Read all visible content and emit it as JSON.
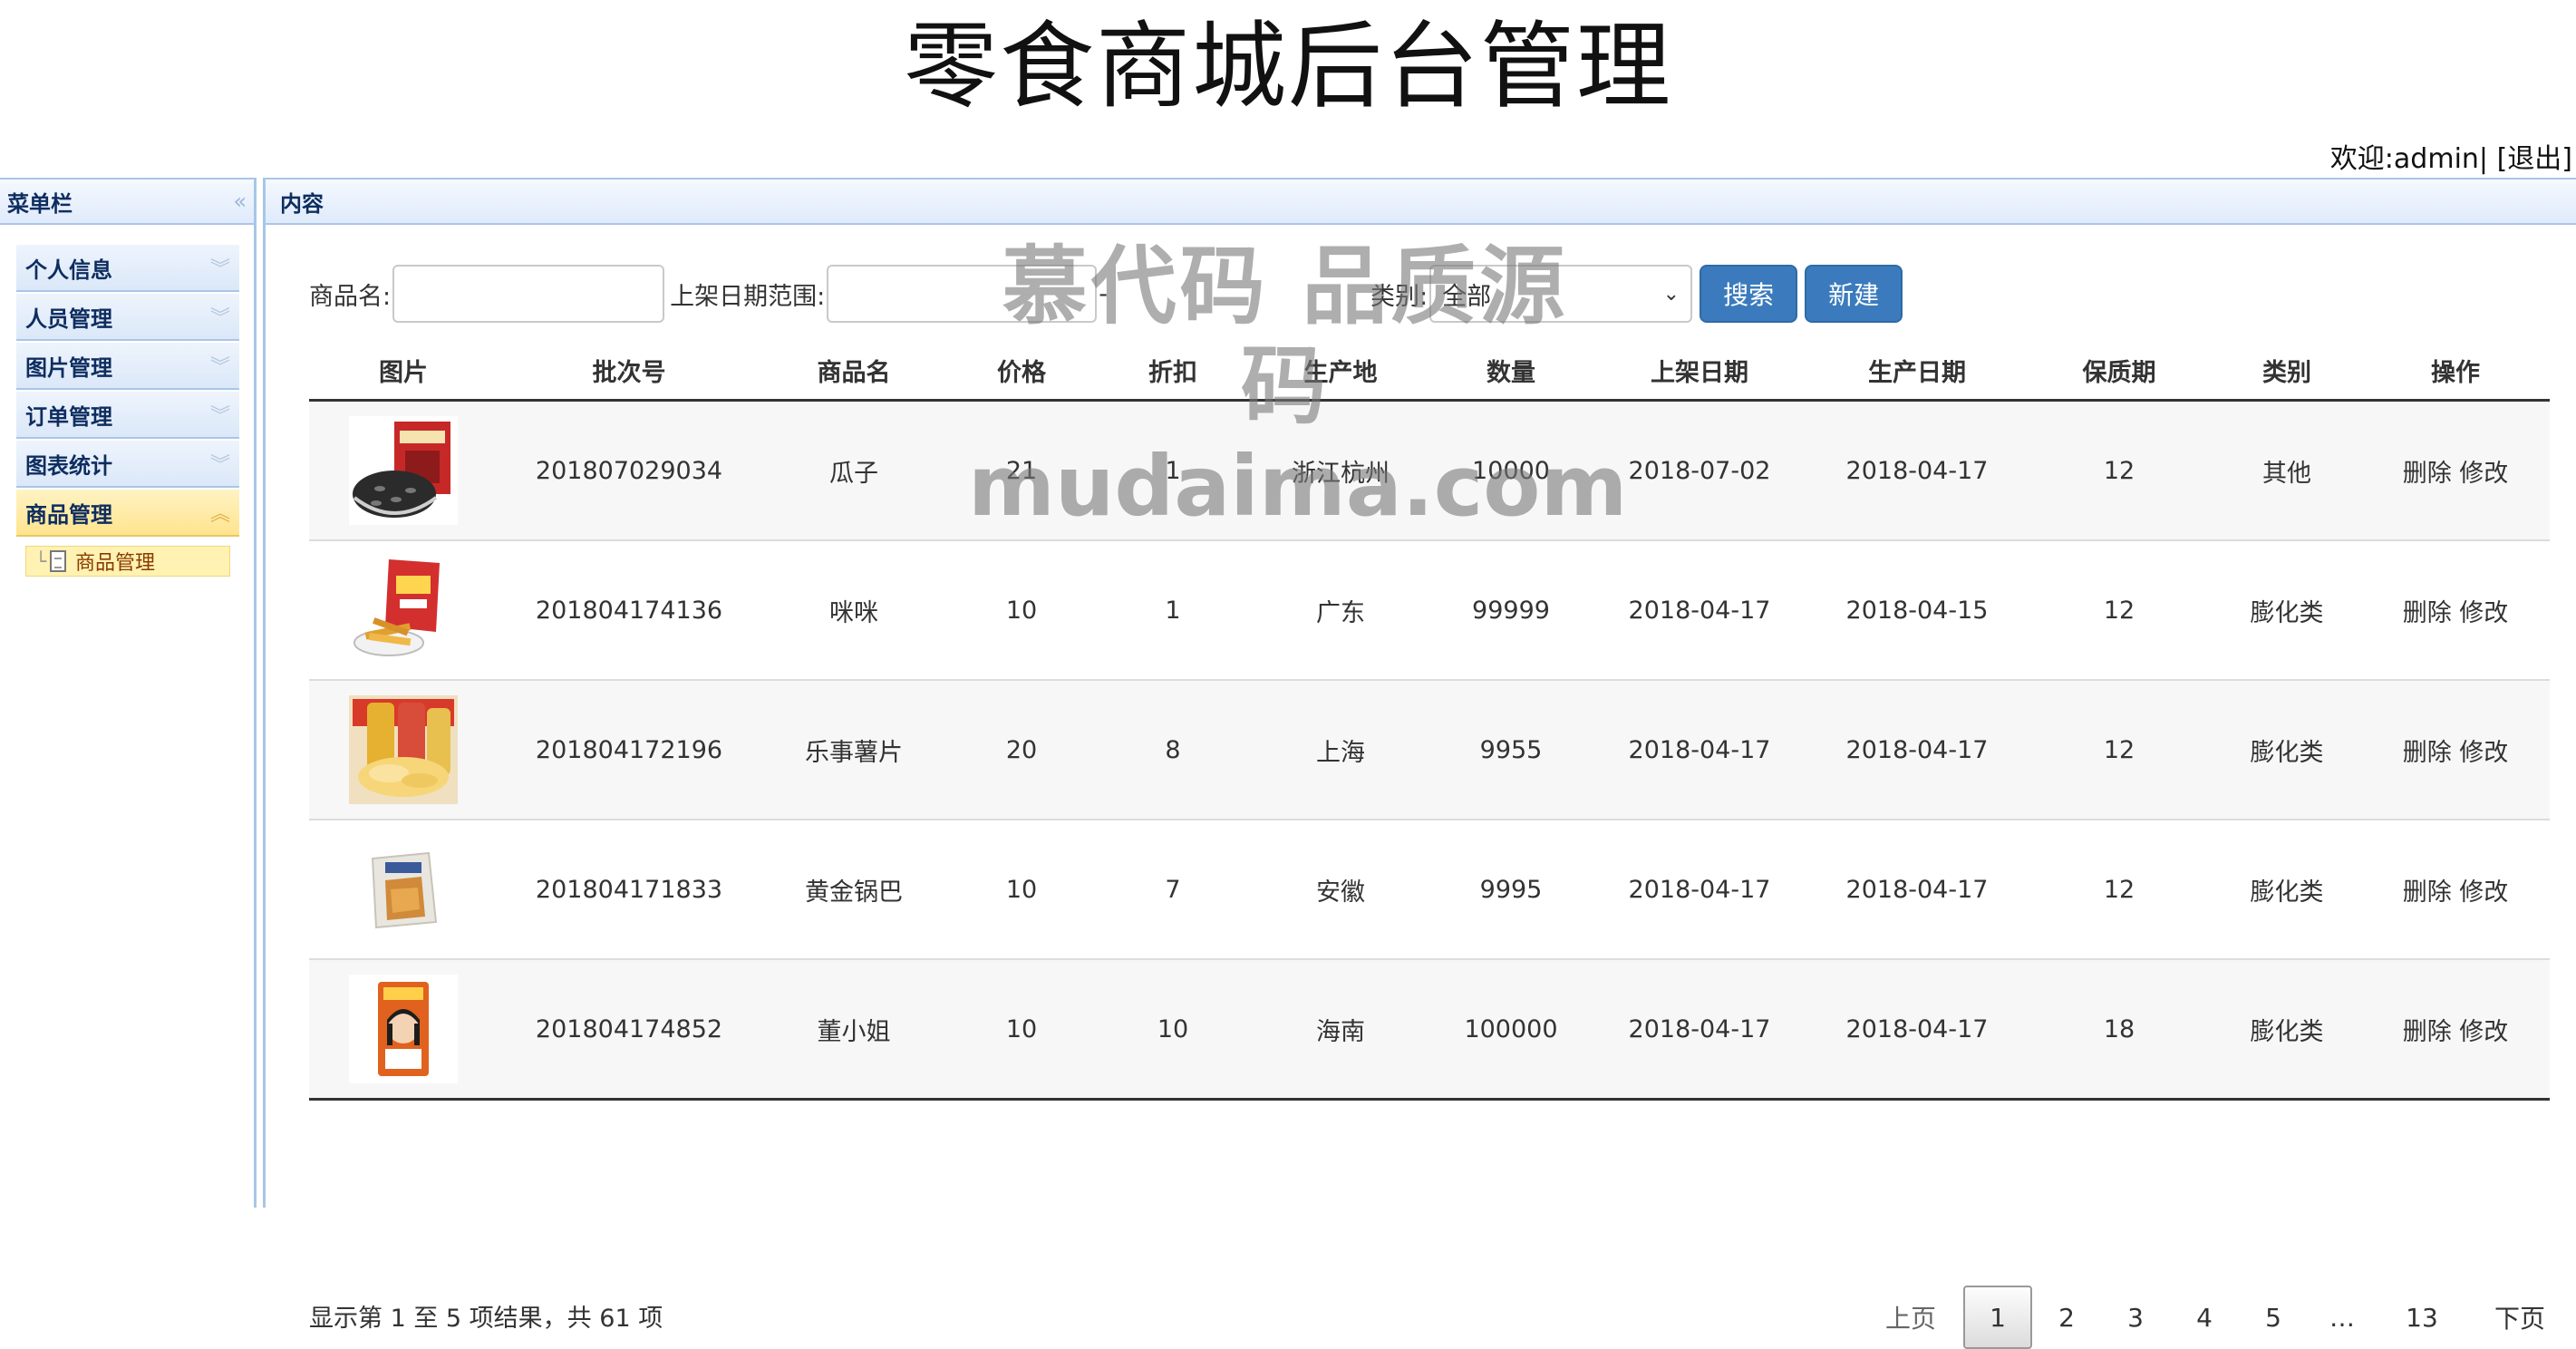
{
  "page": {
    "title": "零食商城后台管理"
  },
  "user": {
    "welcome": "欢迎:admin|",
    "logout": "[退出]"
  },
  "sidebar": {
    "title": "菜单栏",
    "items": [
      {
        "label": "个人信息"
      },
      {
        "label": "人员管理"
      },
      {
        "label": "图片管理"
      },
      {
        "label": "订单管理"
      },
      {
        "label": "图表统计"
      },
      {
        "label": "商品管理",
        "active": true
      }
    ],
    "sub_items": [
      {
        "label": "商品管理"
      }
    ]
  },
  "content": {
    "title": "内容"
  },
  "search": {
    "name_label": "商品名:",
    "name_value": "",
    "date_label": "上架日期范围:",
    "date_from": "",
    "date_sep": "-",
    "date_to": "",
    "category_label": "类别:",
    "category_value": "全部",
    "search_button": "搜索",
    "new_button": "新建"
  },
  "table": {
    "headers": [
      "图片",
      "批次号",
      "商品名",
      "价格",
      "折扣",
      "生产地",
      "数量",
      "上架日期",
      "生产日期",
      "保质期",
      "类别",
      "操作"
    ],
    "rows": [
      {
        "image": "sunflower-seeds-image",
        "batch": "201807029034",
        "name": "瓜子",
        "price": "21",
        "discount": "1",
        "origin": "浙江杭州",
        "qty": "10000",
        "listed": "2018-07-02",
        "produced": "2018-04-17",
        "shelf_life": "12",
        "category": "其他",
        "delete": "删除",
        "edit": "修改"
      },
      {
        "image": "mimi-snack-image",
        "batch": "201804174136",
        "name": "咪咪",
        "price": "10",
        "discount": "1",
        "origin": "广东",
        "qty": "99999",
        "listed": "2018-04-17",
        "produced": "2018-04-15",
        "shelf_life": "12",
        "category": "膨化类",
        "delete": "删除",
        "edit": "修改"
      },
      {
        "image": "lays-chips-image",
        "batch": "201804172196",
        "name": "乐事薯片",
        "price": "20",
        "discount": "8",
        "origin": "上海",
        "qty": "9955",
        "listed": "2018-04-17",
        "produced": "2018-04-17",
        "shelf_life": "12",
        "category": "膨化类",
        "delete": "删除",
        "edit": "修改"
      },
      {
        "image": "golden-crisps-image",
        "batch": "201804171833",
        "name": "黄金锅巴",
        "price": "10",
        "discount": "7",
        "origin": "安徽",
        "qty": "9995",
        "listed": "2018-04-17",
        "produced": "2018-04-17",
        "shelf_life": "12",
        "category": "膨化类",
        "delete": "删除",
        "edit": "修改"
      },
      {
        "image": "dong-xiaojie-image",
        "batch": "201804174852",
        "name": "董小姐",
        "price": "10",
        "discount": "10",
        "origin": "海南",
        "qty": "100000",
        "listed": "2018-04-17",
        "produced": "2018-04-17",
        "shelf_life": "18",
        "category": "膨化类",
        "delete": "删除",
        "edit": "修改"
      }
    ]
  },
  "footer": {
    "info": "显示第 1 至 5 项结果，共 61 项"
  },
  "pagination": {
    "prev": "上页",
    "pages": [
      "1",
      "2",
      "3",
      "4",
      "5"
    ],
    "current": "1",
    "ellipsis": "…",
    "last": "13",
    "next": "下页"
  },
  "watermark": {
    "line1": "慕代码 品质源码",
    "line2": "mudaima.com"
  },
  "colors": {
    "button_primary": "#3b7bbd",
    "panel_border": "#a8c6e6",
    "active_menu": "#ffe48e"
  }
}
